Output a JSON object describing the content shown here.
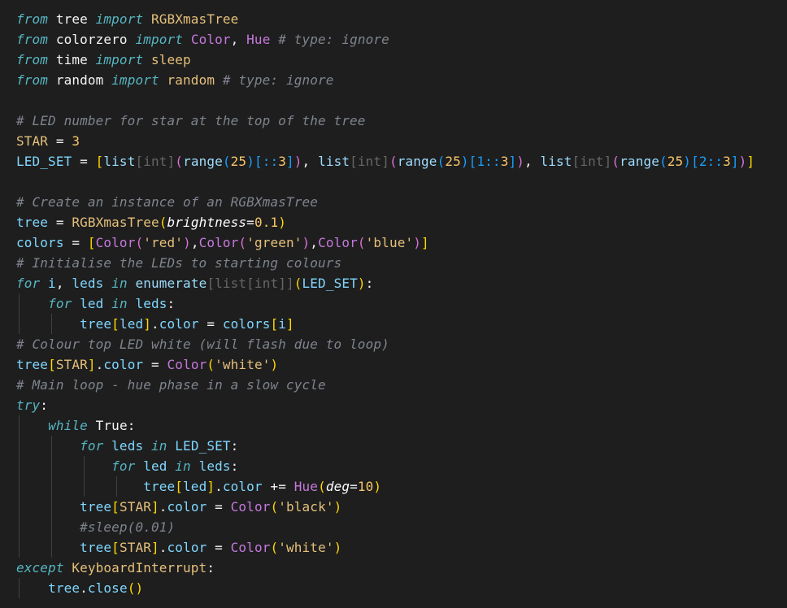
{
  "editor": {
    "lines": [
      [
        [
          "kw",
          "from"
        ],
        [
          "mod",
          " tree "
        ],
        [
          "kw",
          "import"
        ],
        [
          "cls",
          " RGBXmasTree"
        ]
      ],
      [
        [
          "kw",
          "from"
        ],
        [
          "mod",
          " colorzero "
        ],
        [
          "kw",
          "import"
        ],
        [
          "par",
          " "
        ],
        [
          "bld",
          "Color"
        ],
        [
          "op",
          ", "
        ],
        [
          "bld",
          "Hue"
        ],
        [
          "cmt",
          " # type: ignore"
        ]
      ],
      [
        [
          "kw",
          "from"
        ],
        [
          "mod",
          " time "
        ],
        [
          "kw",
          "import"
        ],
        [
          "fnc",
          " sleep"
        ]
      ],
      [
        [
          "kw",
          "from"
        ],
        [
          "mod",
          " random "
        ],
        [
          "kw",
          "import"
        ],
        [
          "fnc",
          " random"
        ],
        [
          "cmt",
          " # type: ignore"
        ]
      ],
      [],
      [
        [
          "cmt",
          "# LED number for star at the top of the tree"
        ]
      ],
      [
        [
          "cst",
          "STAR"
        ],
        [
          "op",
          " = "
        ],
        [
          "num",
          "3"
        ]
      ],
      [
        [
          "var",
          "LED_SET"
        ],
        [
          "op",
          " = "
        ],
        [
          "br1",
          "["
        ],
        [
          "bi",
          "list"
        ],
        [
          "dim",
          "[int]"
        ],
        [
          "br2",
          "("
        ],
        [
          "bi",
          "range"
        ],
        [
          "br3",
          "("
        ],
        [
          "num",
          "25"
        ],
        [
          "br3",
          ")"
        ],
        [
          "br3",
          "[::"
        ],
        [
          "num",
          "3"
        ],
        [
          "br3",
          "]"
        ],
        [
          "br2",
          ")"
        ],
        [
          "op",
          ", "
        ],
        [
          "bi",
          "list"
        ],
        [
          "dim",
          "[int]"
        ],
        [
          "br2",
          "("
        ],
        [
          "bi",
          "range"
        ],
        [
          "br3",
          "("
        ],
        [
          "num",
          "25"
        ],
        [
          "br3",
          ")"
        ],
        [
          "br3",
          "[1::"
        ],
        [
          "num",
          "3"
        ],
        [
          "br3",
          "]"
        ],
        [
          "br2",
          ")"
        ],
        [
          "op",
          ", "
        ],
        [
          "bi",
          "list"
        ],
        [
          "dim",
          "[int]"
        ],
        [
          "br2",
          "("
        ],
        [
          "bi",
          "range"
        ],
        [
          "br3",
          "("
        ],
        [
          "num",
          "25"
        ],
        [
          "br3",
          ")"
        ],
        [
          "br3",
          "[2::"
        ],
        [
          "num",
          "3"
        ],
        [
          "br3",
          "]"
        ],
        [
          "br2",
          ")"
        ],
        [
          "br1",
          "]"
        ]
      ],
      [],
      [
        [
          "cmt",
          "# Create an instance of an RGBXmasTree"
        ]
      ],
      [
        [
          "var",
          "tree"
        ],
        [
          "op",
          " = "
        ],
        [
          "cls",
          "RGBXmasTree"
        ],
        [
          "br1",
          "("
        ],
        [
          "prm",
          "brightness"
        ],
        [
          "op",
          "="
        ],
        [
          "num",
          "0.1"
        ],
        [
          "br1",
          ")"
        ]
      ],
      [
        [
          "var",
          "colors"
        ],
        [
          "op",
          " = "
        ],
        [
          "br1",
          "["
        ],
        [
          "bld",
          "Color"
        ],
        [
          "br2",
          "("
        ],
        [
          "str",
          "'red'"
        ],
        [
          "br2",
          ")"
        ],
        [
          "op",
          ","
        ],
        [
          "bld",
          "Color"
        ],
        [
          "br2",
          "("
        ],
        [
          "str",
          "'green'"
        ],
        [
          "br2",
          ")"
        ],
        [
          "op",
          ","
        ],
        [
          "bld",
          "Color"
        ],
        [
          "br2",
          "("
        ],
        [
          "str",
          "'blue'"
        ],
        [
          "br2",
          ")"
        ],
        [
          "br1",
          "]"
        ]
      ],
      [
        [
          "cmt",
          "# Initialise the LEDs to starting colours"
        ]
      ],
      [
        [
          "ctl",
          "for"
        ],
        [
          "var",
          " i"
        ],
        [
          "op",
          ", "
        ],
        [
          "var",
          "leds"
        ],
        [
          "ctl",
          " in"
        ],
        [
          "bi",
          " enumerate"
        ],
        [
          "dim",
          "[list[int]]"
        ],
        [
          "br1",
          "("
        ],
        [
          "var",
          "LED_SET"
        ],
        [
          "br1",
          ")"
        ],
        [
          "op",
          ":"
        ]
      ],
      [
        [
          "par",
          "    "
        ],
        [
          "ctl",
          "for"
        ],
        [
          "var",
          " led"
        ],
        [
          "ctl",
          " in"
        ],
        [
          "var",
          " leds"
        ],
        [
          "op",
          ":"
        ]
      ],
      [
        [
          "par",
          "        "
        ],
        [
          "var",
          "tree"
        ],
        [
          "br1",
          "["
        ],
        [
          "var",
          "led"
        ],
        [
          "br1",
          "]"
        ],
        [
          "op",
          "."
        ],
        [
          "var",
          "color"
        ],
        [
          "op",
          " = "
        ],
        [
          "var",
          "colors"
        ],
        [
          "br1",
          "["
        ],
        [
          "var",
          "i"
        ],
        [
          "br1",
          "]"
        ]
      ],
      [
        [
          "cmt",
          "# Colour top LED white (will flash due to loop)"
        ]
      ],
      [
        [
          "var",
          "tree"
        ],
        [
          "br1",
          "["
        ],
        [
          "cst",
          "STAR"
        ],
        [
          "br1",
          "]"
        ],
        [
          "op",
          "."
        ],
        [
          "var",
          "color"
        ],
        [
          "op",
          " = "
        ],
        [
          "bld",
          "Color"
        ],
        [
          "br1",
          "("
        ],
        [
          "str",
          "'white'"
        ],
        [
          "br1",
          ")"
        ]
      ],
      [
        [
          "cmt",
          "# Main loop - hue phase in a slow cycle"
        ]
      ],
      [
        [
          "ctl",
          "try"
        ],
        [
          "op",
          ":"
        ]
      ],
      [
        [
          "par",
          "    "
        ],
        [
          "ctl",
          "while"
        ],
        [
          "op",
          " True:"
        ]
      ],
      [
        [
          "par",
          "        "
        ],
        [
          "ctl",
          "for"
        ],
        [
          "var",
          " leds"
        ],
        [
          "ctl",
          " in"
        ],
        [
          "var",
          " LED_SET"
        ],
        [
          "op",
          ":"
        ]
      ],
      [
        [
          "par",
          "            "
        ],
        [
          "ctl",
          "for"
        ],
        [
          "var",
          " led"
        ],
        [
          "ctl",
          " in"
        ],
        [
          "var",
          " leds"
        ],
        [
          "op",
          ":"
        ]
      ],
      [
        [
          "par",
          "                "
        ],
        [
          "var",
          "tree"
        ],
        [
          "br1",
          "["
        ],
        [
          "var",
          "led"
        ],
        [
          "br1",
          "]"
        ],
        [
          "op",
          "."
        ],
        [
          "var",
          "color"
        ],
        [
          "op",
          " += "
        ],
        [
          "bld",
          "Hue"
        ],
        [
          "br1",
          "("
        ],
        [
          "prm",
          "deg"
        ],
        [
          "op",
          "="
        ],
        [
          "num",
          "10"
        ],
        [
          "br1",
          ")"
        ]
      ],
      [
        [
          "par",
          "        "
        ],
        [
          "var",
          "tree"
        ],
        [
          "br1",
          "["
        ],
        [
          "cst",
          "STAR"
        ],
        [
          "br1",
          "]"
        ],
        [
          "op",
          "."
        ],
        [
          "var",
          "color"
        ],
        [
          "op",
          " = "
        ],
        [
          "bld",
          "Color"
        ],
        [
          "br1",
          "("
        ],
        [
          "str",
          "'black'"
        ],
        [
          "br1",
          ")"
        ]
      ],
      [
        [
          "par",
          "        "
        ],
        [
          "cmt",
          "#sleep(0.01)"
        ]
      ],
      [
        [
          "par",
          "        "
        ],
        [
          "var",
          "tree"
        ],
        [
          "br1",
          "["
        ],
        [
          "cst",
          "STAR"
        ],
        [
          "br1",
          "]"
        ],
        [
          "op",
          "."
        ],
        [
          "var",
          "color"
        ],
        [
          "op",
          " = "
        ],
        [
          "bld",
          "Color"
        ],
        [
          "br1",
          "("
        ],
        [
          "str",
          "'white'"
        ],
        [
          "br1",
          ")"
        ]
      ],
      [
        [
          "ctl",
          "except"
        ],
        [
          "cls",
          " KeyboardInterrupt"
        ],
        [
          "op",
          ":"
        ]
      ],
      [
        [
          "par",
          "    "
        ],
        [
          "var",
          "tree"
        ],
        [
          "op",
          "."
        ],
        [
          "var",
          "close"
        ],
        [
          "br1",
          "()"
        ]
      ]
    ]
  }
}
